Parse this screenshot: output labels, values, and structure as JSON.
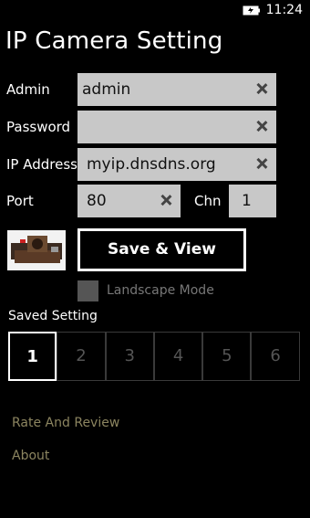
{
  "status": {
    "time": "11:24"
  },
  "page": {
    "title": "IP Camera Setting"
  },
  "form": {
    "admin_label": "Admin",
    "admin_value": "admin",
    "password_label": "Password",
    "password_value": "",
    "ip_label": "IP Address",
    "ip_value": "myip.dnsdns.org",
    "port_label": "Port",
    "port_value": "80",
    "chn_label": "Chn",
    "chn_value": "1"
  },
  "actions": {
    "save_view_label": "Save & View",
    "landscape_label": "Landscape Mode"
  },
  "saved": {
    "title": "Saved Setting",
    "slots": [
      "1",
      "2",
      "3",
      "4",
      "5",
      "6"
    ],
    "active_slot": "1"
  },
  "links": {
    "rate_label": "Rate And Review",
    "about_label": "About"
  }
}
